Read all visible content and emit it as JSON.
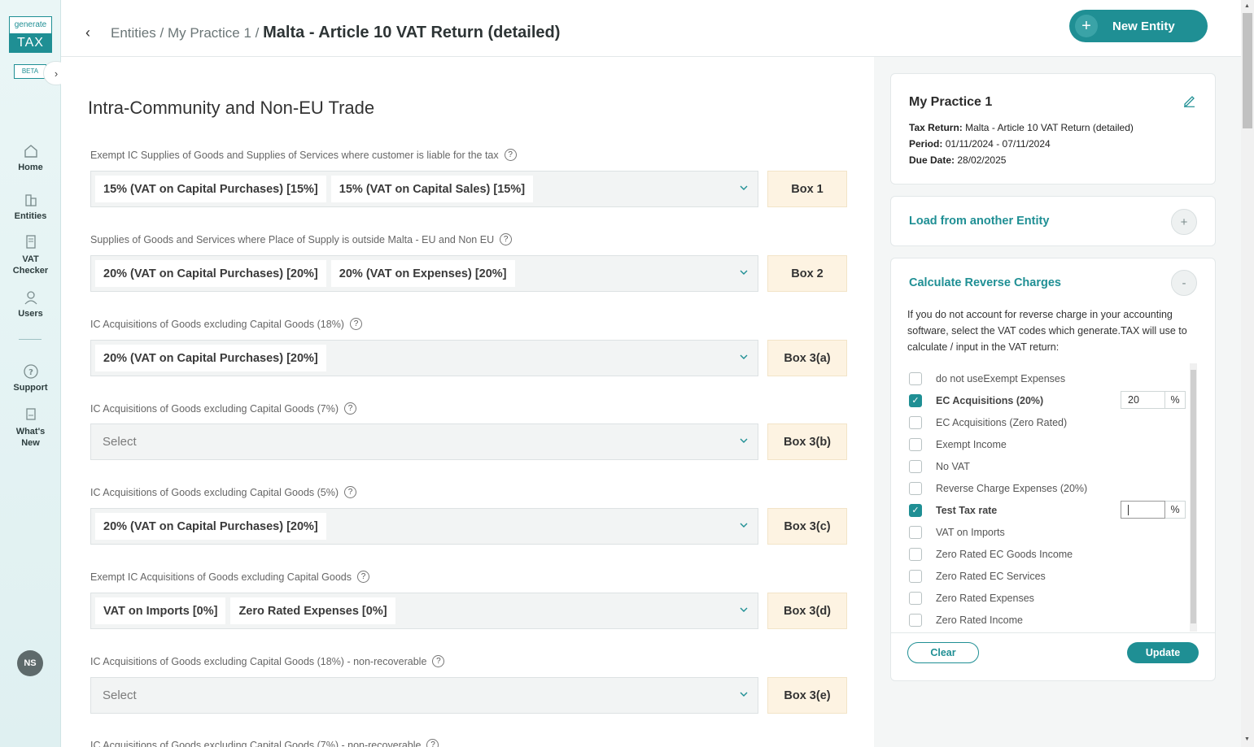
{
  "sidebar": {
    "logo_top": "generate",
    "logo_bottom": "TAX",
    "beta": "BETA",
    "items": [
      {
        "label": "Home",
        "icon": "home-icon"
      },
      {
        "label": "Entities",
        "icon": "building-icon"
      },
      {
        "label": "VAT\nChecker",
        "icon": "document-icon"
      },
      {
        "label": "Users",
        "icon": "user-icon"
      },
      {
        "label": "Support",
        "icon": "help-icon"
      },
      {
        "label": "What's\nNew",
        "icon": "news-icon"
      }
    ],
    "avatar": "NS"
  },
  "header": {
    "breadcrumb_entities": "Entities",
    "breadcrumb_sep": "/",
    "breadcrumb_practice": "My Practice 1",
    "breadcrumb_current": "Malta - Article 10 VAT Return (detailed)",
    "new_entity": "New Entity"
  },
  "main": {
    "title": "Intra-Community and Non-EU Trade",
    "fields": [
      {
        "label": "Exempt IC Supplies of Goods and Supplies of Services where customer is liable for the tax",
        "chips": [
          "15% (VAT on Capital Purchases) [15%]",
          "15% (VAT on Capital Sales) [15%]"
        ],
        "box": "Box 1"
      },
      {
        "label": "Supplies of Goods and Services where Place of Supply is outside Malta - EU and Non EU",
        "chips": [
          "20% (VAT on Capital Purchases) [20%]",
          "20% (VAT on Expenses) [20%]"
        ],
        "box": "Box 2"
      },
      {
        "label": "IC Acquisitions of Goods excluding Capital Goods (18%)",
        "chips": [
          "20% (VAT on Capital Purchases) [20%]"
        ],
        "box": "Box 3(a)"
      },
      {
        "label": "IC Acquisitions of Goods excluding Capital Goods (7%)",
        "chips": [],
        "placeholder": "Select",
        "box": "Box 3(b)"
      },
      {
        "label": "IC Acquisitions of Goods excluding Capital Goods (5%)",
        "chips": [
          "20% (VAT on Capital Purchases) [20%]"
        ],
        "box": "Box 3(c)"
      },
      {
        "label": "Exempt IC Acquisitions of Goods excluding Capital Goods",
        "chips": [
          "VAT on Imports [0%]",
          "Zero Rated Expenses [0%]"
        ],
        "box": "Box 3(d)"
      },
      {
        "label": "IC Acquisitions of Goods excluding Capital Goods (18%) - non-recoverable",
        "chips": [],
        "placeholder": "Select",
        "box": "Box 3(e)"
      },
      {
        "label": "IC Acquisitions of Goods excluding Capital Goods (7%) - non-recoverable",
        "chips": [],
        "box": ""
      }
    ]
  },
  "panel": {
    "practice_name": "My Practice 1",
    "tax_return_label": "Tax Return:",
    "tax_return_value": "Malta - Article 10 VAT Return (detailed)",
    "period_label": "Period:",
    "period_value": "01/11/2024 - 07/11/2024",
    "due_label": "Due Date:",
    "due_value": "28/02/2025",
    "load_title": "Load from another Entity",
    "reverse_title": "Calculate Reverse Charges",
    "reverse_desc": "If you do not account for reverse charge in your accounting software, select the VAT codes which generate.TAX will use to calculate / input in the VAT return:",
    "codes": [
      {
        "label": "do not useExempt Expenses",
        "checked": false
      },
      {
        "label": "EC Acquisitions (20%)",
        "checked": true,
        "value": "20"
      },
      {
        "label": "EC Acquisitions (Zero Rated)",
        "checked": false
      },
      {
        "label": "Exempt Income",
        "checked": false
      },
      {
        "label": "No VAT",
        "checked": false
      },
      {
        "label": "Reverse Charge Expenses (20%)",
        "checked": false
      },
      {
        "label": "Test Tax rate",
        "checked": true,
        "value": ""
      },
      {
        "label": "VAT on Imports",
        "checked": false
      },
      {
        "label": "Zero Rated EC Goods Income",
        "checked": false
      },
      {
        "label": "Zero Rated EC Services",
        "checked": false
      },
      {
        "label": "Zero Rated Expenses",
        "checked": false
      },
      {
        "label": "Zero Rated Income",
        "checked": false
      }
    ],
    "pct_symbol": "%",
    "clear": "Clear",
    "update": "Update"
  }
}
